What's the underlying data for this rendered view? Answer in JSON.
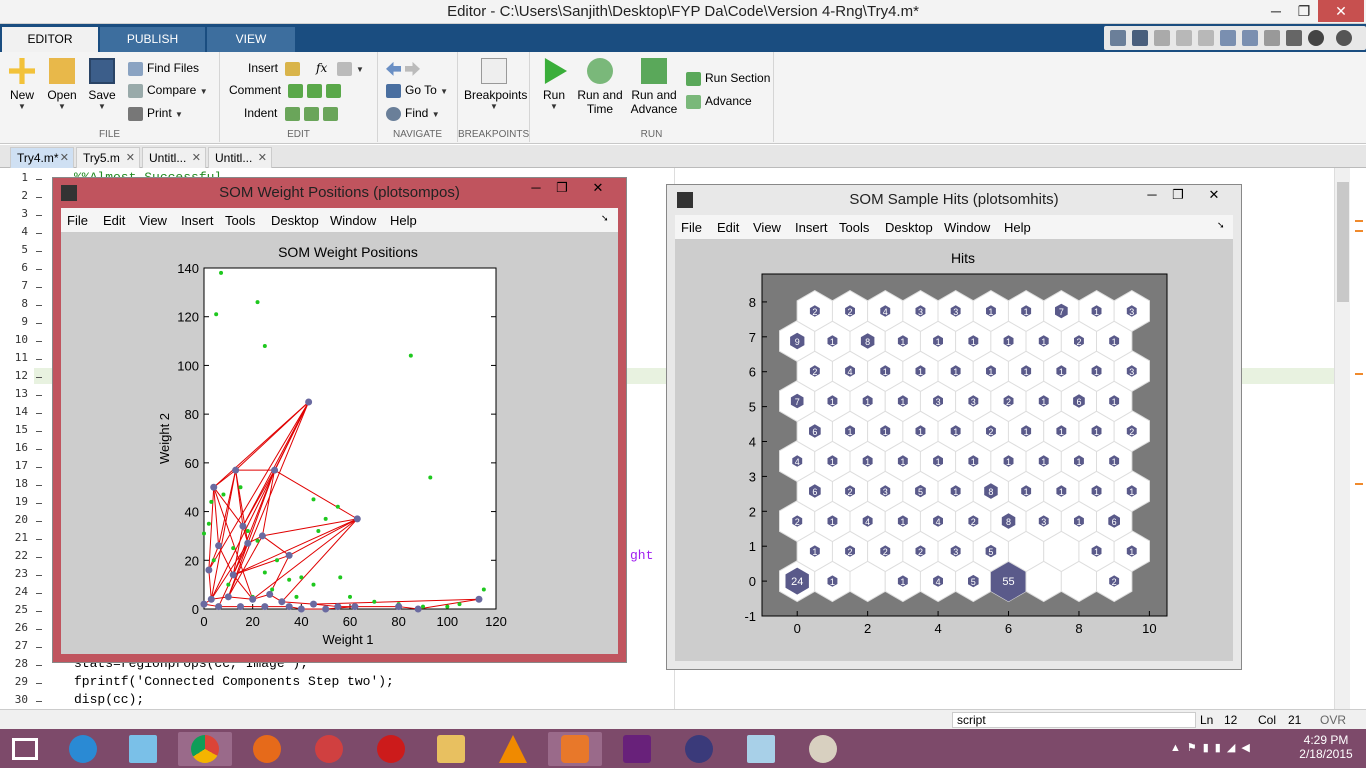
{
  "window": {
    "title": "Editor - C:\\Users\\Sanjith\\Desktop\\FYP Da\\Code\\Version 4-Rng\\Try4.m*",
    "min": "─",
    "max": "❐",
    "close": "✕"
  },
  "ribbon_tabs": [
    "EDITOR",
    "PUBLISH",
    "VIEW"
  ],
  "ribbon": {
    "file": {
      "label": "FILE",
      "new": "New",
      "open": "Open",
      "save": "Save",
      "find_files": "Find Files",
      "compare": "Compare",
      "print": "Print"
    },
    "edit": {
      "label": "EDIT",
      "insert": "Insert",
      "comment": "Comment",
      "indent": "Indent",
      "fx": "fx"
    },
    "navigate": {
      "label": "NAVIGATE",
      "goto": "Go To",
      "find": "Find"
    },
    "breakpoints": {
      "label": "BREAKPOINTS",
      "btn": "Breakpoints"
    },
    "run": {
      "label": "RUN",
      "run": "Run",
      "run_time_1": "Run and",
      "run_time_2": "Time",
      "run_adv_1": "Run and",
      "run_adv_2": "Advance",
      "run_section": "Run Section",
      "advance": "Advance"
    }
  },
  "file_tabs": [
    {
      "name": "Try4.m*"
    },
    {
      "name": "Try5.m"
    },
    {
      "name": "Untitl..."
    },
    {
      "name": "Untitl..."
    }
  ],
  "code": {
    "line1": "%%Almost Successful",
    "line22_tail": "ght",
    "line28": "stats=regionprops(cc,'Image');",
    "line29": "fprintf('Connected Components Step two');",
    "line30": "disp(cc);"
  },
  "line_numbers": [
    "1",
    "2",
    "3",
    "4",
    "5",
    "6",
    "7",
    "8",
    "9",
    "10",
    "11",
    "12",
    "13",
    "14",
    "15",
    "16",
    "17",
    "18",
    "19",
    "20",
    "21",
    "22",
    "23",
    "24",
    "25",
    "26",
    "27",
    "28",
    "29",
    "30"
  ],
  "status": {
    "mode": "script",
    "ln_label": "Ln",
    "ln": "12",
    "col_label": "Col",
    "col": "21",
    "ovr": "OVR"
  },
  "tray": {
    "time": "4:29 PM",
    "date": "2/18/2015"
  },
  "fig1": {
    "title": "SOM Weight Positions (plotsompos)",
    "menu": [
      "File",
      "Edit",
      "View",
      "Insert",
      "Tools",
      "Desktop",
      "Window",
      "Help"
    ],
    "chart_data": {
      "type": "scatter",
      "title": "SOM Weight Positions",
      "xlabel": "Weight 1",
      "ylabel": "Weight 2",
      "xlim": [
        0,
        120
      ],
      "ylim": [
        0,
        140
      ],
      "xticks": [
        "0",
        "20",
        "40",
        "60",
        "80",
        "100",
        "120"
      ],
      "yticks": [
        "0",
        "20",
        "40",
        "60",
        "80",
        "100",
        "120",
        "140"
      ],
      "input_points": [
        [
          7,
          138
        ],
        [
          5,
          121
        ],
        [
          22,
          126
        ],
        [
          25,
          108
        ],
        [
          85,
          104
        ],
        [
          93,
          54
        ],
        [
          45,
          45
        ],
        [
          55,
          42
        ],
        [
          50,
          37
        ],
        [
          47,
          32
        ],
        [
          3,
          44
        ],
        [
          8,
          47
        ],
        [
          2,
          35
        ],
        [
          4,
          20
        ],
        [
          12,
          25
        ],
        [
          18,
          32
        ],
        [
          22,
          28
        ],
        [
          25,
          15
        ],
        [
          30,
          20
        ],
        [
          35,
          12
        ],
        [
          40,
          13
        ],
        [
          45,
          10
        ],
        [
          56,
          13
        ],
        [
          0,
          31
        ],
        [
          115,
          8
        ],
        [
          60,
          5
        ],
        [
          70,
          3
        ],
        [
          80,
          2
        ],
        [
          90,
          1
        ],
        [
          100,
          1
        ],
        [
          105,
          2
        ],
        [
          15,
          50
        ],
        [
          20,
          5
        ],
        [
          10,
          10
        ],
        [
          28,
          8
        ],
        [
          38,
          5
        ]
      ],
      "neurons": [
        [
          43,
          85
        ],
        [
          13,
          57
        ],
        [
          29,
          57
        ],
        [
          4,
          50
        ],
        [
          63,
          37
        ],
        [
          16,
          34
        ],
        [
          18,
          27
        ],
        [
          24,
          30
        ],
        [
          35,
          22
        ],
        [
          6,
          26
        ],
        [
          2,
          16
        ],
        [
          12,
          14
        ],
        [
          3,
          4
        ],
        [
          10,
          5
        ],
        [
          20,
          4
        ],
        [
          27,
          6
        ],
        [
          32,
          3
        ],
        [
          45,
          2
        ],
        [
          55,
          1
        ],
        [
          62,
          1
        ],
        [
          80,
          1
        ],
        [
          88,
          0
        ],
        [
          113,
          4
        ],
        [
          0,
          2
        ],
        [
          6,
          1
        ],
        [
          15,
          1
        ],
        [
          25,
          1
        ],
        [
          35,
          1
        ],
        [
          40,
          0
        ],
        [
          50,
          0
        ]
      ],
      "edges": [
        [
          0,
          1
        ],
        [
          0,
          2
        ],
        [
          0,
          3
        ],
        [
          0,
          5
        ],
        [
          0,
          10
        ],
        [
          0,
          12
        ],
        [
          1,
          2
        ],
        [
          1,
          3
        ],
        [
          1,
          5
        ],
        [
          1,
          6
        ],
        [
          1,
          9
        ],
        [
          2,
          4
        ],
        [
          2,
          5
        ],
        [
          2,
          7
        ],
        [
          2,
          13
        ],
        [
          3,
          5
        ],
        [
          3,
          9
        ],
        [
          3,
          10
        ],
        [
          4,
          7
        ],
        [
          4,
          8
        ],
        [
          4,
          11
        ],
        [
          4,
          14
        ],
        [
          4,
          16
        ],
        [
          5,
          6
        ],
        [
          5,
          11
        ],
        [
          6,
          7
        ],
        [
          6,
          12
        ],
        [
          7,
          8
        ],
        [
          7,
          13
        ],
        [
          8,
          15
        ],
        [
          8,
          11
        ],
        [
          9,
          10
        ],
        [
          9,
          11
        ],
        [
          10,
          12
        ],
        [
          11,
          14
        ],
        [
          12,
          13
        ],
        [
          13,
          14
        ],
        [
          14,
          15
        ],
        [
          15,
          16
        ],
        [
          16,
          17
        ],
        [
          17,
          18
        ],
        [
          18,
          19
        ],
        [
          19,
          20
        ],
        [
          20,
          21
        ],
        [
          21,
          22
        ],
        [
          17,
          22
        ],
        [
          12,
          23
        ],
        [
          23,
          24
        ],
        [
          24,
          25
        ],
        [
          25,
          26
        ],
        [
          26,
          27
        ],
        [
          27,
          28
        ],
        [
          28,
          29
        ],
        [
          29,
          19
        ],
        [
          6,
          24
        ],
        [
          1,
          12
        ],
        [
          0,
          13
        ],
        [
          2,
          11
        ],
        [
          3,
          14
        ]
      ]
    }
  },
  "fig2": {
    "title": "SOM Sample Hits (plotsomhits)",
    "menu": [
      "File",
      "Edit",
      "View",
      "Insert",
      "Tools",
      "Desktop",
      "Window",
      "Help"
    ],
    "chart_data": {
      "type": "heatmap",
      "title": "Hits",
      "xlim": [
        -1,
        10.5
      ],
      "ylim": [
        -1,
        8.8
      ],
      "xticks": [
        "0",
        "2",
        "4",
        "6",
        "8",
        "10"
      ],
      "yticks": [
        "-1",
        "0",
        "1",
        "2",
        "3",
        "4",
        "5",
        "6",
        "7",
        "8"
      ],
      "grid_cols": 10,
      "grid_rows": 9,
      "hits": [
        [
          24,
          1,
          0,
          1,
          4,
          5,
          55,
          0,
          0,
          2
        ],
        [
          1,
          2,
          2,
          2,
          3,
          5,
          0,
          0,
          1,
          1
        ],
        [
          2,
          1,
          4,
          1,
          4,
          2,
          8,
          3,
          1,
          6
        ],
        [
          6,
          2,
          3,
          5,
          1,
          8,
          1,
          1,
          1,
          1
        ],
        [
          4,
          1,
          1,
          1,
          1,
          1,
          1,
          1,
          1,
          1
        ],
        [
          6,
          1,
          1,
          1,
          1,
          2,
          1,
          1,
          1,
          2
        ],
        [
          7,
          1,
          1,
          1,
          3,
          3,
          2,
          1,
          6,
          1
        ],
        [
          2,
          4,
          1,
          1,
          1,
          1,
          1,
          1,
          1,
          3
        ],
        [
          9,
          1,
          8,
          1,
          1,
          1,
          1,
          1,
          2,
          1
        ],
        [
          2,
          2,
          4,
          3,
          3,
          1,
          1,
          7,
          1,
          3
        ]
      ]
    }
  },
  "colors": {
    "matlab_blue": "#1a4d80",
    "fig1_border": "#c0545e",
    "taskbar": "#7d4a6a",
    "neuron": "#6a6aa0",
    "edge": "#e00000",
    "input": "#1ec81e",
    "hex_hit": "#5a5a8a"
  }
}
